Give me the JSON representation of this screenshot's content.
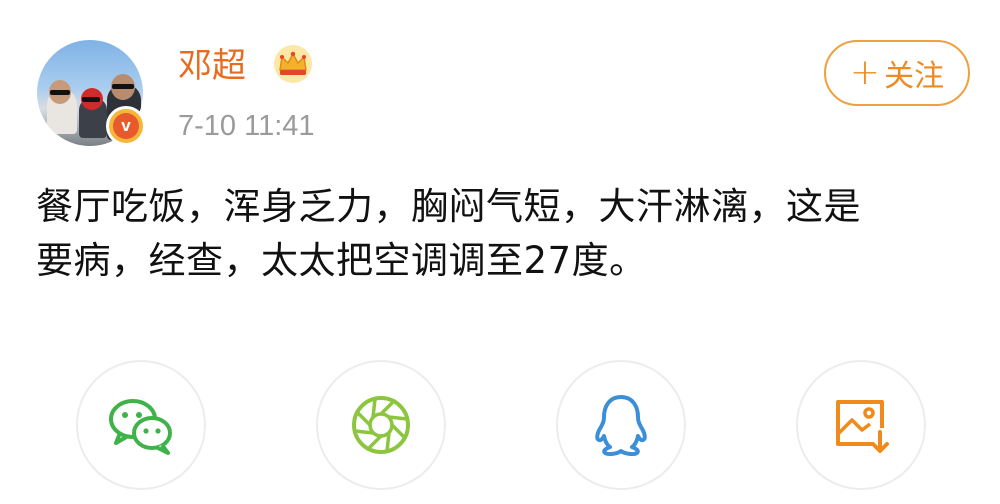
{
  "post": {
    "author": {
      "name": "邓超",
      "avatar_icon": "avatar-photo",
      "verified_badge_icon": "verified-v-badge",
      "vip_icon": "crown-icon"
    },
    "timestamp": "7-10 11:41",
    "follow_button": {
      "plus": "+",
      "label": "关注"
    },
    "text": "餐厅吃饭，浑身乏力，胸闷气短，大汗淋漓，这是\n要病，经查，太太把空调调至27度。"
  },
  "share_buttons": [
    {
      "icon": "wechat-icon"
    },
    {
      "icon": "moments-icon"
    },
    {
      "icon": "qq-icon"
    },
    {
      "icon": "save-image-icon"
    }
  ],
  "colors": {
    "username": "#e86b1f",
    "follow_border": "#f0a03c",
    "timestamp": "#9a9a9a",
    "wechat_green": "#3fb34a",
    "moments_green": "#8cc63e",
    "qq_blue": "#3a8fd8",
    "save_orange": "#f08a1c"
  }
}
